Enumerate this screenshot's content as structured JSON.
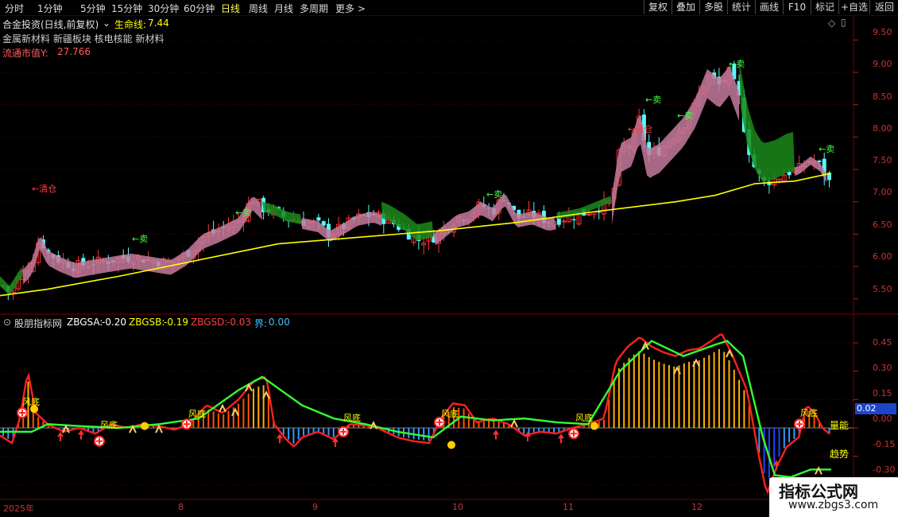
{
  "toolbar": {
    "periods": [
      "分时",
      "1分钟",
      "5分钟",
      "15分钟",
      "30分钟",
      "60分钟",
      "日线",
      "周线",
      "月线",
      "多周期",
      "更多 >"
    ],
    "active_period": "日线",
    "right_buttons": [
      "复权",
      "叠加",
      "多股",
      "统计",
      "画线",
      "F10",
      "标记",
      "+自选",
      "返回"
    ]
  },
  "main_chart": {
    "title": "合金投资(日线,前复权)",
    "life_line_label": "生命线:",
    "life_line_value": "7.44",
    "sectors": "金属新材料 新疆板块 核电核能 新材料",
    "float_cap_label": "流通市值Y:",
    "float_cap_value": "27.766",
    "y_ticks": [
      "9.50",
      "9.00",
      "8.50",
      "8.00",
      "7.50",
      "7.00",
      "6.50",
      "6.00",
      "5.50"
    ],
    "y_range": [
      5.3,
      9.7
    ],
    "signals": [
      {
        "text": "←清仓",
        "price": 7.0
      },
      {
        "text": "←卖",
        "price": 6.3
      },
      {
        "text": "←卖",
        "price": 6.6
      },
      {
        "text": "←卖",
        "price": 6.9
      },
      {
        "text": "←卖",
        "price": 8.45
      },
      {
        "text": "←清仓",
        "price": 7.8
      },
      {
        "text": "←卖",
        "price": 8.2
      },
      {
        "text": "←卖",
        "price": 9.0
      },
      {
        "text": "←卖",
        "price": 7.6
      }
    ],
    "colors": {
      "up": "#ff3232",
      "down": "#54fcfc",
      "life_line": "#ffff00",
      "band_up": "#c37a9c",
      "band_down": "#1b8a1b"
    }
  },
  "indicator": {
    "name": "股朋指标网",
    "zbgsa_label": "ZBGSA:",
    "zbgsa_value": "-0.20",
    "zbgsb_label": "ZBGSB:",
    "zbgsb_value": "-0.19",
    "zbgsd_label": "ZBGSD:",
    "zbgsd_value": "-0.03",
    "jie_label": "界:",
    "jie_value": "0.00",
    "y_ticks": [
      "0.45",
      "0.30",
      "0.15",
      "0.00",
      "-0.15",
      "-0.30"
    ],
    "y_range": [
      -0.37,
      0.53
    ],
    "current_tag": "0.02",
    "labels": {
      "liang_neng": "量能",
      "qu_shi": "趋势",
      "feng_di": "风底"
    }
  },
  "x_axis": {
    "labels": [
      "2025年",
      "8",
      "9",
      "10",
      "11",
      "12"
    ]
  },
  "watermark": {
    "title": "指标公式网",
    "url": "www.zbgs3.com"
  }
}
